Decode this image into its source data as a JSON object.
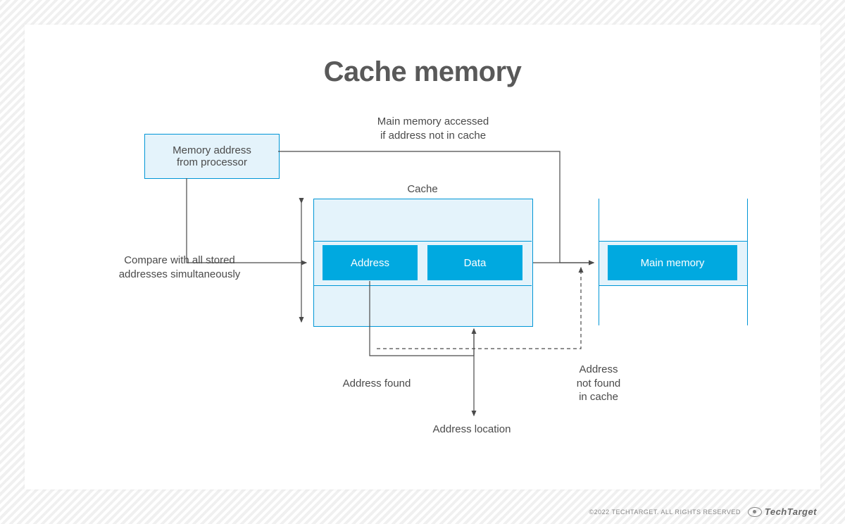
{
  "title": "Cache memory",
  "boxes": {
    "processor": "Memory address\nfrom processor",
    "cache_header": "Cache",
    "address": "Address",
    "data": "Data",
    "main_memory": "Main memory"
  },
  "labels": {
    "top_note": "Main memory accessed\nif address not in cache",
    "compare": "Compare with all stored\naddresses simultaneously",
    "addr_found": "Address found",
    "addr_location": "Address location",
    "not_found": "Address\nnot found\nin cache"
  },
  "footer": {
    "copyright": "©2022 TECHTARGET. ALL RIGHTS RESERVED",
    "brand": "TechTarget"
  }
}
